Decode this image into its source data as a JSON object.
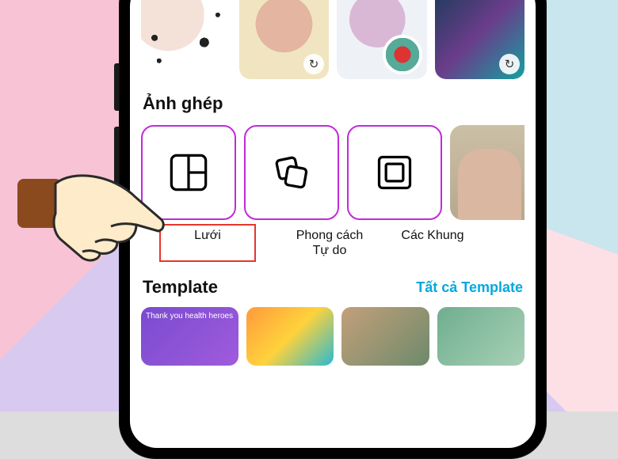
{
  "effects_row": {
    "items": [
      {
        "has_reload": false
      },
      {
        "has_reload": true
      },
      {
        "has_reload": false
      },
      {
        "has_reload": true
      }
    ]
  },
  "collage": {
    "section_title": "Ảnh ghép",
    "options": [
      {
        "icon": "grid",
        "label": "Lưới",
        "highlighted": true
      },
      {
        "icon": "free",
        "label": "Phong cách\nTự do",
        "highlighted": false
      },
      {
        "icon": "frames",
        "label": "Các Khung",
        "highlighted": false
      }
    ]
  },
  "templates": {
    "section_title": "Template",
    "see_all_label": "Tất cả Template",
    "items": [
      {
        "caption": "Thank you health heroes"
      },
      {
        "caption": ""
      },
      {
        "caption": ""
      },
      {
        "caption": ""
      }
    ]
  },
  "overlay": {
    "hand_points_to": "collage.options.0"
  }
}
